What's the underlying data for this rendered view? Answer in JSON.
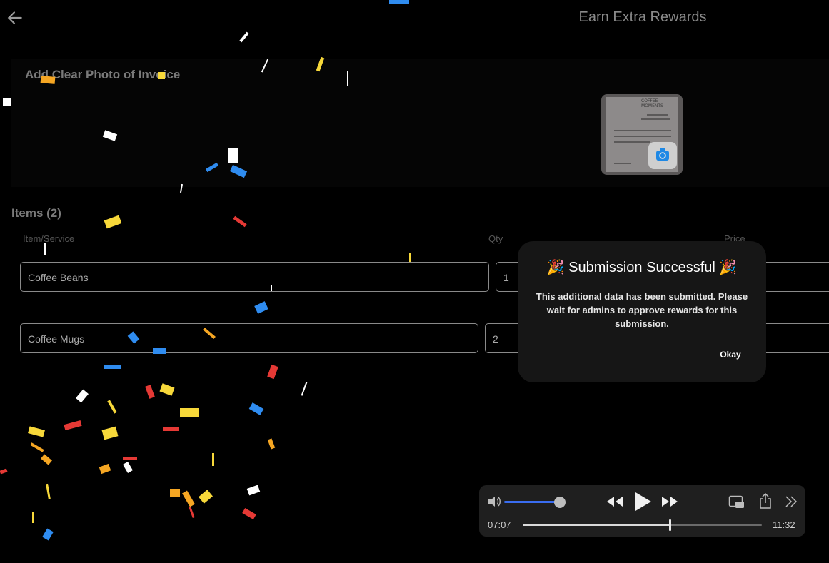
{
  "header": {
    "title": "Earn Extra Rewards",
    "back_icon": "arrow-left-icon"
  },
  "photo": {
    "label": "Add Clear Photo of Invoice",
    "thumb_lines": [
      "COFFEE",
      "MOMENTS"
    ],
    "camera_icon": "camera-icon"
  },
  "items": {
    "heading": "Items (2)",
    "columns": [
      "Item/Service",
      "Qty",
      "Price"
    ],
    "rows": [
      {
        "name": "Coffee Beans",
        "qty": "1"
      },
      {
        "name": "Coffee Mugs",
        "qty": "2"
      }
    ]
  },
  "dialog": {
    "emoji_left": "🎉",
    "title": "Submission Successful",
    "emoji_right": "🎉",
    "body": "This additional data has been submitted. Please wait for admins to approve rewards for this submission.",
    "ok_label": "Okay"
  },
  "player": {
    "elapsed": "07:07",
    "remaining": "11:32",
    "volume": 0.9,
    "progress": 0.61,
    "icons": [
      "volume-icon",
      "rewind-icon",
      "play-icon",
      "fast-forward-icon",
      "picture-in-picture-icon",
      "share-icon",
      "more-icon"
    ]
  },
  "colors": {
    "accent": "#3a6df0",
    "confetti": [
      "#ffffff",
      "#f7d83a",
      "#f5a623",
      "#2f8cf0",
      "#e53935"
    ]
  }
}
